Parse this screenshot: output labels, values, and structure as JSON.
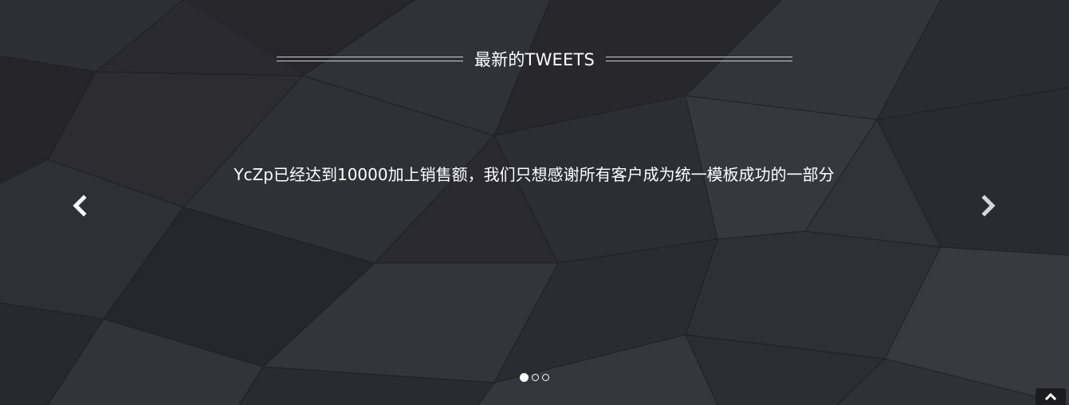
{
  "section": {
    "heading": "最新的TWEETS",
    "tweet_text": "YcZp已经达到10000加上销售额，我们只想感谢所有客户成为统一模板成功的一部分"
  },
  "carousel": {
    "prev_icon": "chevron-left-icon",
    "next_icon": "chevron-right-icon",
    "slide_count": 3,
    "active_index": 0
  },
  "back_to_top_icon": "chevron-up-icon",
  "colors": {
    "text": "#ffffff",
    "background": "#28282e"
  }
}
